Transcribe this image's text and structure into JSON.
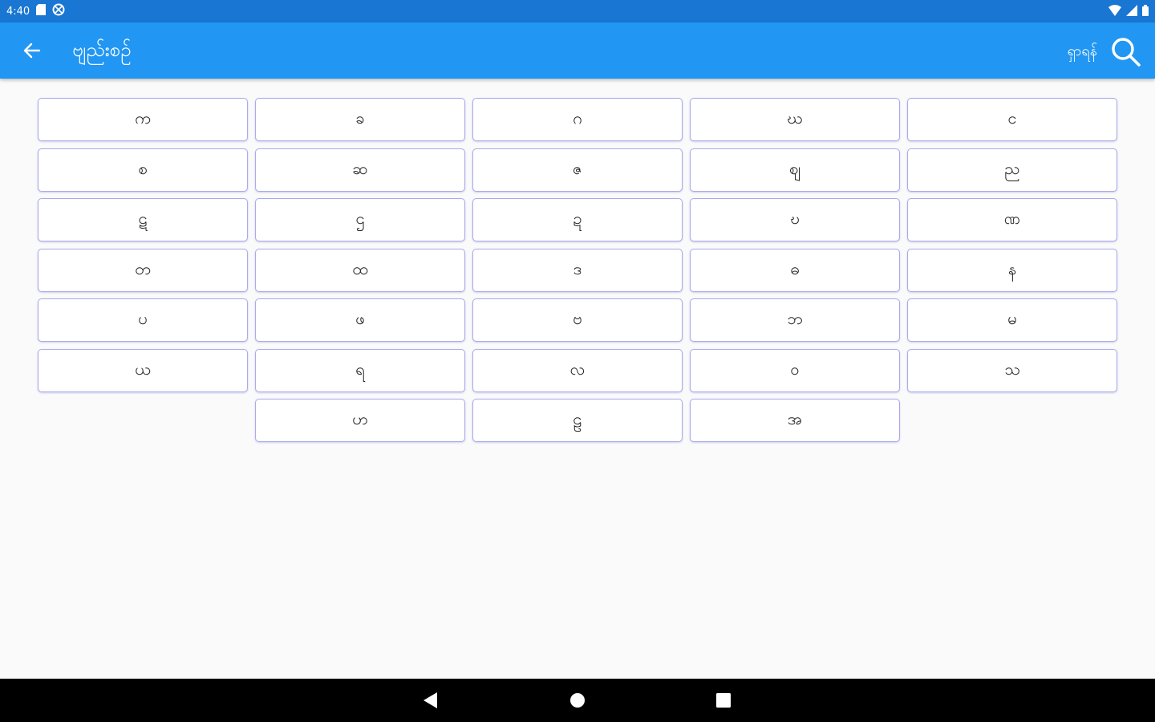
{
  "status_bar": {
    "time": "4:40"
  },
  "app_bar": {
    "title": "ဗျည်းစဥ်",
    "search_label": "ရှာရန်"
  },
  "letters": [
    "က",
    "ခ",
    "ဂ",
    "ဃ",
    "င",
    "စ",
    "ဆ",
    "ဇ",
    "ဈ",
    "ည",
    "ဋ",
    "ဌ",
    "ဍ",
    "ဎ",
    "ဏ",
    "တ",
    "ထ",
    "ဒ",
    "ဓ",
    "န",
    "ပ",
    "ဖ",
    "ဗ",
    "ဘ",
    "မ",
    "ယ",
    "ရ",
    "လ",
    "ဝ",
    "သ",
    "ဟ",
    "ဠ",
    "အ"
  ],
  "colors": {
    "status_bar": "#1976d2",
    "app_bar": "#2196f3",
    "key_border": "#aaaaee",
    "background": "#fafafa"
  }
}
